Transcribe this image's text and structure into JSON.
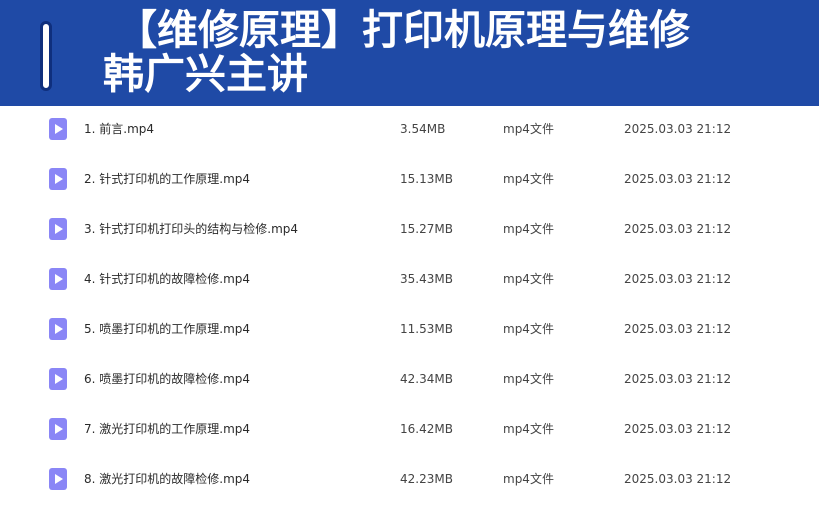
{
  "banner": {
    "title": "【维修原理】打印机原理与维修",
    "subtitle": "韩广兴主讲"
  },
  "colors": {
    "banner_bg": "#1f4aa6",
    "file_icon": "#8a86f6"
  },
  "files": [
    {
      "name": "1. 前言.mp4",
      "size": "3.54MB",
      "type": "mp4文件",
      "date": "2025.03.03 21:12",
      "icon": "video-file-icon"
    },
    {
      "name": "2. 针式打印机的工作原理.mp4",
      "size": "15.13MB",
      "type": "mp4文件",
      "date": "2025.03.03 21:12",
      "icon": "video-file-icon"
    },
    {
      "name": "3. 针式打印机打印头的结构与检修.mp4",
      "size": "15.27MB",
      "type": "mp4文件",
      "date": "2025.03.03 21:12",
      "icon": "video-file-icon"
    },
    {
      "name": "4. 针式打印机的故障检修.mp4",
      "size": "35.43MB",
      "type": "mp4文件",
      "date": "2025.03.03 21:12",
      "icon": "video-file-icon"
    },
    {
      "name": "5. 喷墨打印机的工作原理.mp4",
      "size": "11.53MB",
      "type": "mp4文件",
      "date": "2025.03.03 21:12",
      "icon": "video-file-icon"
    },
    {
      "name": "6. 喷墨打印机的故障检修.mp4",
      "size": "42.34MB",
      "type": "mp4文件",
      "date": "2025.03.03 21:12",
      "icon": "video-file-icon"
    },
    {
      "name": "7. 激光打印机的工作原理.mp4",
      "size": "16.42MB",
      "type": "mp4文件",
      "date": "2025.03.03 21:12",
      "icon": "video-file-icon"
    },
    {
      "name": "8. 激光打印机的故障检修.mp4",
      "size": "42.23MB",
      "type": "mp4文件",
      "date": "2025.03.03 21:12",
      "icon": "video-file-icon"
    }
  ]
}
